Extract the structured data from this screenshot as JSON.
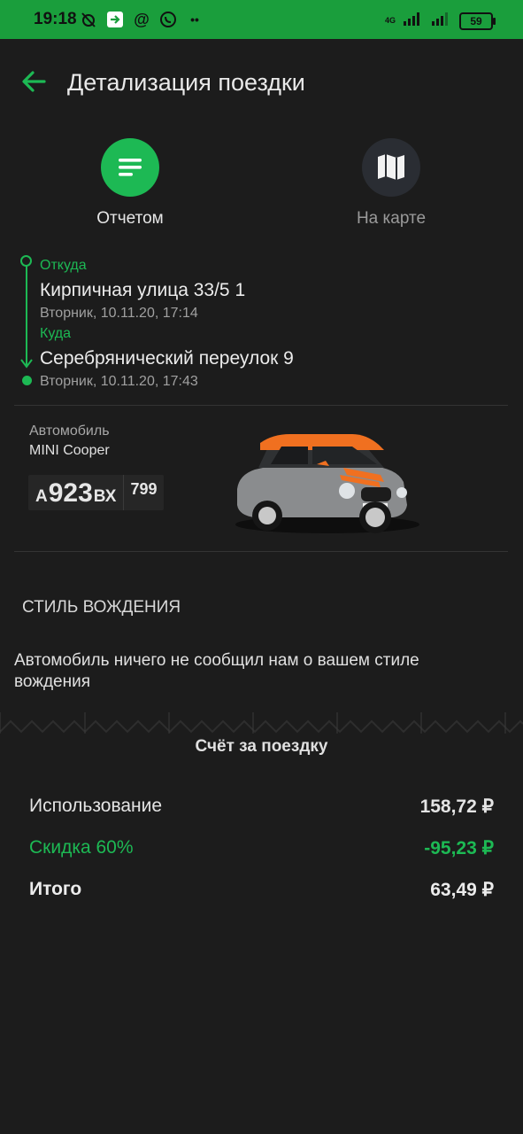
{
  "status_bar": {
    "time": "19:18",
    "network": "4G",
    "battery": "59"
  },
  "header": {
    "title": "Детализация поездки"
  },
  "view_modes": [
    {
      "label": "Отчетом",
      "icon": "list-icon",
      "active": true
    },
    {
      "label": "На карте",
      "icon": "map-icon",
      "active": false
    }
  ],
  "route": {
    "from_label": "Откуда",
    "from_address": "Кирпичная улица 33/5 1",
    "from_time": "Вторник, 10.11.20, 17:14",
    "to_label": "Куда",
    "to_address": "Серебрянический переулок 9",
    "to_time": "Вторник, 10.11.20, 17:43"
  },
  "car": {
    "label": "Автомобиль",
    "model": "MINI Cooper",
    "plate_letter1": "А",
    "plate_number": "923",
    "plate_letters2": "ВХ",
    "plate_region": "799"
  },
  "driving_style": {
    "title": "СТИЛЬ ВОЖДЕНИЯ",
    "text": "Автомобиль ничего не сообщил нам о вашем стиле вождения"
  },
  "bill": {
    "title": "Счёт за поездку",
    "rows": [
      {
        "label": "Использование",
        "amount": "158,72 ₽"
      },
      {
        "label": "Скидка 60%",
        "amount": "-95,23 ₽"
      },
      {
        "label": "Итого",
        "amount": "63,49 ₽"
      }
    ]
  },
  "colors": {
    "accent": "#1db954",
    "status_bar": "#1a9e3c",
    "background": "#1c1c1c",
    "icon_inactive_bg": "#2a2d33"
  }
}
